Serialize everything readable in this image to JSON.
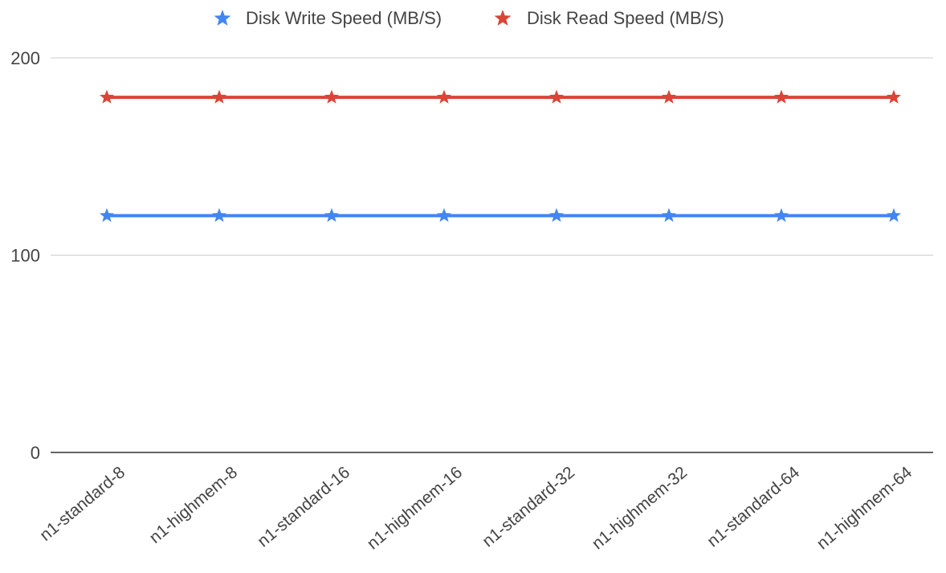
{
  "chart_data": {
    "type": "line",
    "categories": [
      "n1-standard-8",
      "n1-highmem-8",
      "n1-standard-16",
      "n1-highmem-16",
      "n1-standard-32",
      "n1-highmem-32",
      "n1-standard-64",
      "n1-highmem-64"
    ],
    "series": [
      {
        "name": "Disk Write Speed (MB/S)",
        "color": "#4285F4",
        "marker": "star",
        "values": [
          120,
          120,
          120,
          120,
          120,
          120,
          120,
          120
        ]
      },
      {
        "name": "Disk Read Speed (MB/S)",
        "color": "#DB4437",
        "marker": "star",
        "values": [
          180,
          180,
          180,
          180,
          180,
          180,
          180,
          180
        ]
      }
    ],
    "title": "",
    "xlabel": "",
    "ylabel": "",
    "ylim": [
      0,
      200
    ],
    "yticks": [
      0,
      100,
      200
    ],
    "grid": true,
    "legend_position": "top-center"
  }
}
